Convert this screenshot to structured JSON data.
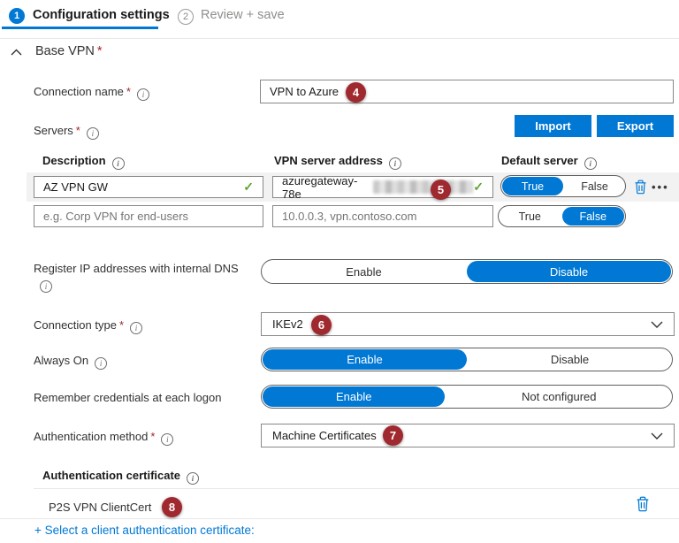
{
  "colors": {
    "accent": "#0078d4",
    "annotation_badge": "#a0282f",
    "valid_check": "#5ea432",
    "link": "#0078d4"
  },
  "steps": [
    {
      "number": "1",
      "label": "Configuration settings",
      "active": true
    },
    {
      "number": "2",
      "label": "Review + save",
      "active": false
    }
  ],
  "section": {
    "title": "Base VPN",
    "required_mark": "*"
  },
  "connection_name": {
    "label": "Connection name",
    "required_mark": "*",
    "value": "VPN to Azure",
    "badge": "4"
  },
  "servers": {
    "label": "Servers",
    "required_mark": "*",
    "import_button": "Import",
    "export_button": "Export",
    "columns": {
      "description": "Description",
      "address": "VPN server address",
      "default_server": "Default server"
    },
    "row1": {
      "description": "AZ VPN GW",
      "address_visible": "azuregateway-78e",
      "address_redacted": true,
      "badge": "5",
      "true_label": "True",
      "false_label": "False",
      "default_selected": "True"
    },
    "row2": {
      "description_placeholder": "e.g. Corp VPN for end-users",
      "address_placeholder": "10.0.0.3, vpn.contoso.com",
      "true_label": "True",
      "false_label": "False",
      "default_selected": "False"
    }
  },
  "register_dns": {
    "label": "Register IP addresses with internal DNS",
    "enable_label": "Enable",
    "disable_label": "Disable",
    "selected": "Disable"
  },
  "connection_type": {
    "label": "Connection type",
    "required_mark": "*",
    "value": "IKEv2",
    "badge": "6"
  },
  "always_on": {
    "label": "Always On",
    "enable_label": "Enable",
    "disable_label": "Disable",
    "selected": "Enable"
  },
  "remember_credentials": {
    "label": "Remember credentials at each logon",
    "enable_label": "Enable",
    "not_configured_label": "Not configured",
    "selected": "Enable"
  },
  "auth_method": {
    "label": "Authentication method",
    "required_mark": "*",
    "value": "Machine Certificates",
    "badge": "7"
  },
  "auth_certificate": {
    "heading": "Authentication certificate",
    "cert_name": "P2S VPN ClientCert",
    "badge": "8",
    "select_link": "+ Select a client authentication certificate:"
  }
}
